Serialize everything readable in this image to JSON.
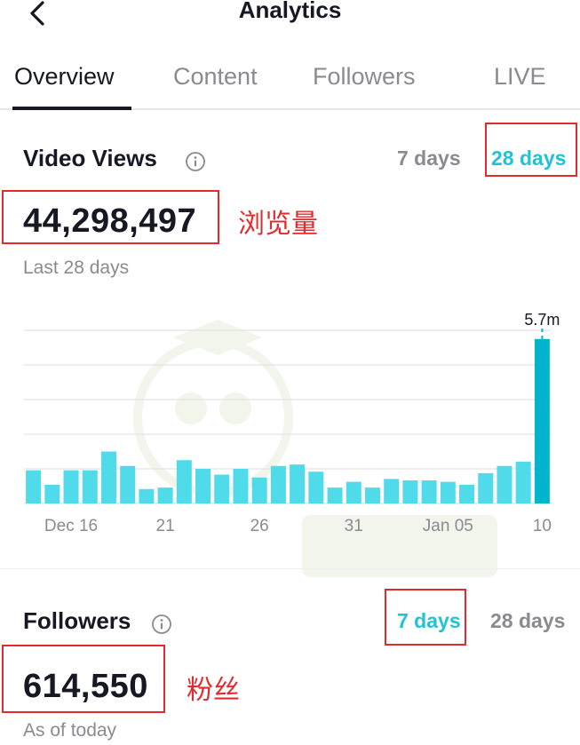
{
  "header": {
    "title": "Analytics"
  },
  "tabs": [
    {
      "label": "Overview",
      "active": true
    },
    {
      "label": "Content",
      "active": false
    },
    {
      "label": "Followers",
      "active": false
    },
    {
      "label": "LIVE",
      "active": false
    }
  ],
  "video_views": {
    "title": "Video Views",
    "range_options": [
      "7 days",
      "28 days"
    ],
    "selected_range": "28 days",
    "total": "44,298,497",
    "annotation": "浏览量",
    "subtext": "Last 28 days"
  },
  "followers": {
    "title": "Followers",
    "range_options": [
      "7 days",
      "28 days"
    ],
    "selected_range": "7 days",
    "total": "614,550",
    "annotation": "粉丝",
    "subtext": "As of today"
  },
  "colors": {
    "accent": "#20c3d6",
    "bar": "#4fdbe9",
    "bar_highlight": "#00b5cc",
    "annotation_red": "#e32b2b",
    "muted_text": "#8a8b91"
  },
  "chart_data": {
    "type": "bar",
    "x": [
      "Dec 14",
      "Dec 15",
      "Dec 16",
      "Dec 17",
      "Dec 18",
      "Dec 19",
      "Dec 20",
      "Dec 21",
      "Dec 22",
      "Dec 23",
      "Dec 24",
      "Dec 25",
      "Dec 26",
      "Dec 27",
      "Dec 28",
      "Dec 29",
      "Dec 30",
      "Dec 31",
      "Jan 01",
      "Jan 02",
      "Jan 03",
      "Jan 04",
      "Jan 05",
      "Jan 06",
      "Jan 07",
      "Jan 08",
      "Jan 09",
      "Jan 10"
    ],
    "values": [
      1.15,
      0.65,
      1.15,
      1.15,
      1.8,
      1.3,
      0.5,
      0.55,
      1.5,
      1.2,
      1.0,
      1.2,
      0.9,
      1.3,
      1.35,
      1.1,
      0.55,
      0.75,
      0.55,
      0.85,
      0.8,
      0.8,
      0.75,
      0.65,
      1.05,
      1.3,
      1.45,
      5.7
    ],
    "tick_labels": [
      {
        "label": "Dec 16",
        "index": 2
      },
      {
        "label": "21",
        "index": 7
      },
      {
        "label": "26",
        "index": 12
      },
      {
        "label": "31",
        "index": 17
      },
      {
        "label": "Jan 05",
        "index": 22
      },
      {
        "label": "10",
        "index": 27
      }
    ],
    "highlight_index": 27,
    "highlight_label": "5.7m",
    "ylim": [
      0,
      6
    ],
    "unit": "m",
    "grid": true
  }
}
